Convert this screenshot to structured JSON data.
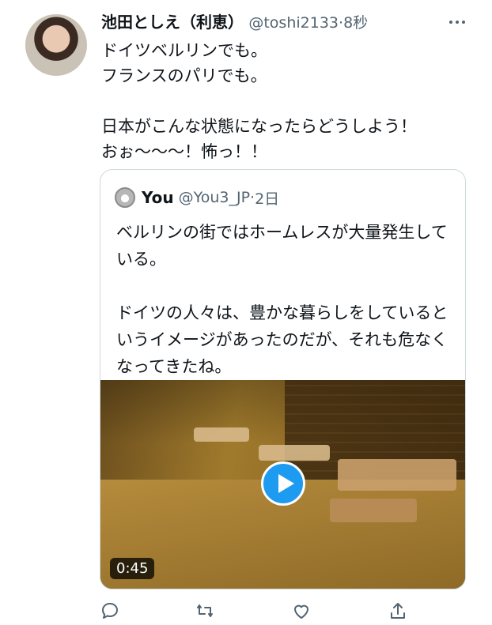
{
  "tweet": {
    "display_name": "池田としえ（利恵）",
    "handle": "@toshi2133",
    "separator": "·",
    "time": "8秒",
    "text": "ドイツベルリンでも。\nフランスのパリでも。\n\n日本がこんな状態になったらどうしよう！\nおぉ〜〜〜！怖っ！！"
  },
  "quote": {
    "display_name": "You",
    "handle": "@You3_JP",
    "separator": "·",
    "time": "2日",
    "text": "ベルリンの街ではホームレスが大量発生している。\n\nドイツの人々は、豊かな暮らしをしているというイメージがあったのだが、それも危なくなってきたね。",
    "video_duration": "0:45"
  },
  "icons": {
    "more": "more-horizontal-icon",
    "reply": "reply-icon",
    "retweet": "retweet-icon",
    "like": "heart-icon",
    "share": "share-icon",
    "play": "play-icon"
  },
  "colors": {
    "accent": "#1d9bf0",
    "secondary_text": "#536471",
    "border": "#cfd9de"
  }
}
